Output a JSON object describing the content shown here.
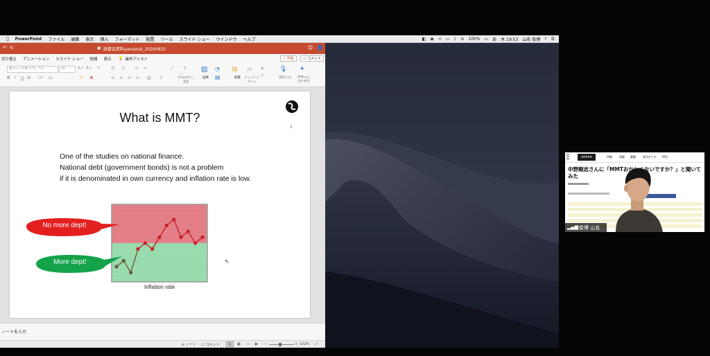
{
  "menubar": {
    "app_name": "PowerPoint",
    "items": [
      "ファイル",
      "編集",
      "表示",
      "挿入",
      "フォーマット",
      "配置",
      "ツール",
      "スライド ショー",
      "ウインドウ",
      "ヘルプ"
    ],
    "battery": "100%",
    "clock": "木 19:53",
    "user": "山名 俊博"
  },
  "window": {
    "title": "読書会資料yamanat_20200925",
    "share_label": "共有",
    "comment_label": "コメント"
  },
  "ribbon": {
    "tabs": [
      "切り替え",
      "アニメーション",
      "スライド ショー",
      "校閲",
      "表示"
    ],
    "tell_me": "操作アシスト",
    "font_name": "游ゴシック体 ミディアム",
    "font_size": "28",
    "smartart_label": "SmartArt に変換",
    "picture_label": "画像",
    "arrange_label": "配置",
    "quick_styles_label": "クイック スタイル",
    "dictate_label": "音声入力",
    "designer_label": "デザイン アイデア"
  },
  "slide": {
    "title": "What is MMT?",
    "page_number": "2",
    "body": [
      "One of the studies on national finance.",
      "National debt (government bonds) is not a problem",
      "if it is denominated in own currency and inflation rate is low."
    ],
    "bubble_top": "No more dept!",
    "bubble_bottom": "More dept!",
    "chart_caption": "Inflation rate",
    "colors": {
      "upper_band": "#e0727a",
      "lower_band": "#8fd8a5",
      "bubble_red": "#e3201f",
      "bubble_green": "#14a34a",
      "line_red": "#c8202a",
      "line_dark": "#6a5a3a"
    }
  },
  "chart_data": {
    "type": "line",
    "title": "",
    "xlabel": "Inflation rate",
    "ylabel": "",
    "series": [
      {
        "values": [
          2,
          3,
          1,
          5,
          6,
          5,
          7,
          9,
          10,
          7,
          8,
          6,
          7
        ]
      }
    ],
    "threshold": 5,
    "ylim": [
      0,
      12
    ]
  },
  "notes": {
    "placeholder": "ノートを入力"
  },
  "statusbar": {
    "notes_label": "ノート",
    "comments_label": "コメント",
    "zoom": "102%"
  },
  "webcam": {
    "participant_name": "俊博 山名",
    "site_logo": "online",
    "nav_items": [
      "特集",
      "連載",
      "書籍",
      "週刊ダイヤ",
      "WSJ"
    ],
    "headline": "中野剛志さんに「MMTおかしくないですか？」と聞いてみた"
  }
}
